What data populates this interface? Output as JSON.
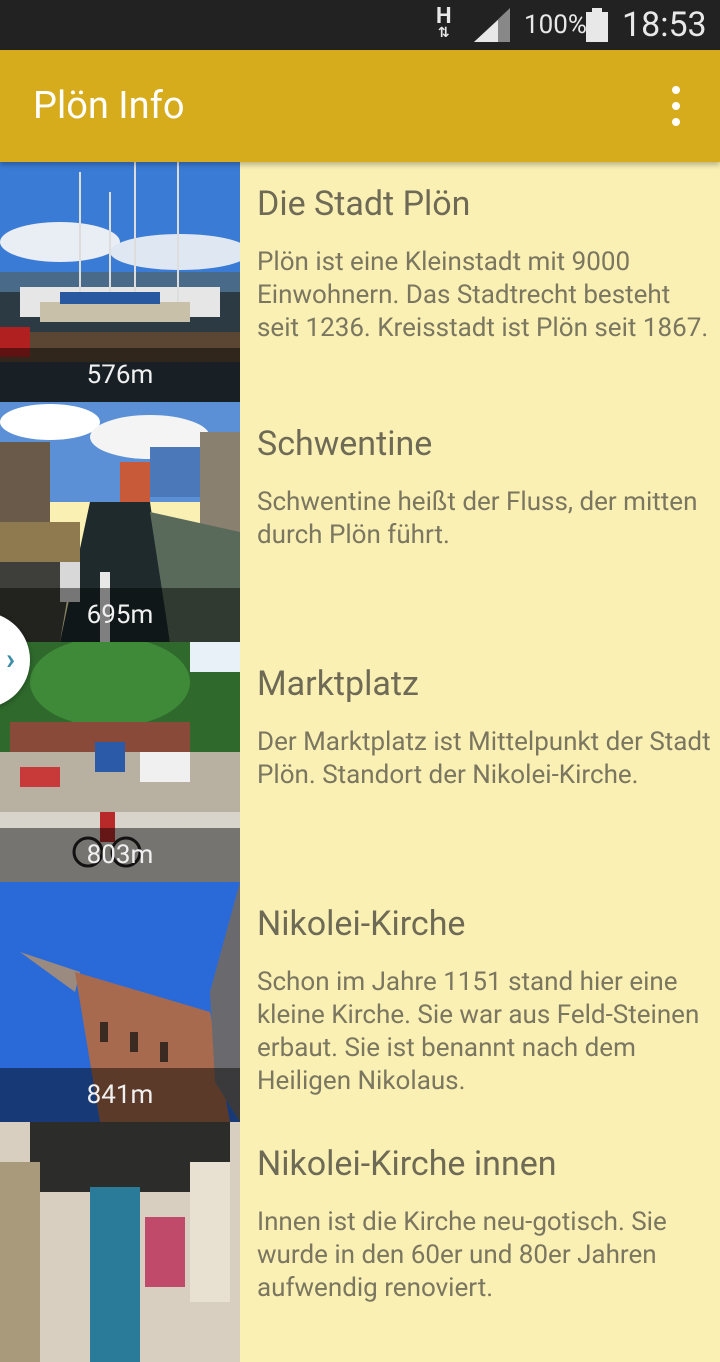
{
  "status_bar": {
    "network": "H",
    "battery_percent": "100%",
    "time": "18:53"
  },
  "app_bar": {
    "title": "Plön Info",
    "menu_icon": "overflow-menu-icon"
  },
  "drawer_toggle_glyph": "›",
  "colors": {
    "app_bar": "#d6ac1c",
    "background": "#faf0b4",
    "status_bar": "#222222",
    "title_text": "#6e6a55"
  },
  "items": [
    {
      "title": "Die Stadt Plön",
      "description": "Plön ist eine Kleinstadt mit 9000 Einwohnern. Das Stadtrecht besteht seit 1236. Kreisstadt ist Plön seit 1867.",
      "distance": "576m"
    },
    {
      "title": "Schwentine",
      "description": "Schwentine heißt der Fluss, der mitten durch Plön führt.",
      "distance": "695m"
    },
    {
      "title": "Marktplatz",
      "description": "Der Marktplatz ist Mittelpunkt der Stadt Plön. Standort der Nikolei-Kirche.",
      "distance": "803m"
    },
    {
      "title": "Nikolei-Kirche",
      "description": "Schon im Jahre 1151 stand hier eine kleine Kirche. Sie war aus Feld-Steinen erbaut. Sie ist benannt nach dem Heiligen Nikolaus.",
      "distance": "841m"
    },
    {
      "title": "Nikolei-Kirche innen",
      "description": "Innen ist die Kirche neu-gotisch. Sie wurde in den 60er und 80er Jahren aufwendig renoviert.",
      "distance": ""
    }
  ]
}
